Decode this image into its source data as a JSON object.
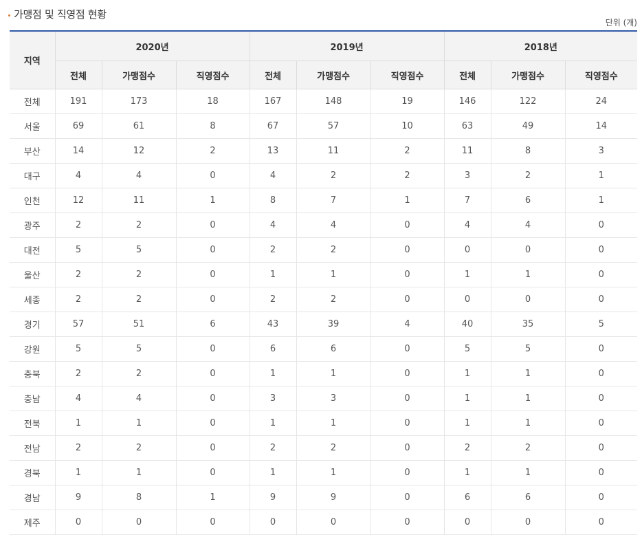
{
  "page": {
    "title": "가맹점 및 직영점 현황",
    "unit": "단위 (개)"
  },
  "table": {
    "region_header": "지역",
    "years": [
      "2020년",
      "2019년",
      "2018년"
    ],
    "sub_headers": [
      "전체",
      "가맹점수",
      "직영점수"
    ],
    "rows": [
      {
        "region": "전체",
        "values": [
          "191",
          "173",
          "18",
          "167",
          "148",
          "19",
          "146",
          "122",
          "24"
        ]
      },
      {
        "region": "서울",
        "values": [
          "69",
          "61",
          "8",
          "67",
          "57",
          "10",
          "63",
          "49",
          "14"
        ]
      },
      {
        "region": "부산",
        "values": [
          "14",
          "12",
          "2",
          "13",
          "11",
          "2",
          "11",
          "8",
          "3"
        ]
      },
      {
        "region": "대구",
        "values": [
          "4",
          "4",
          "0",
          "4",
          "2",
          "2",
          "3",
          "2",
          "1"
        ]
      },
      {
        "region": "인천",
        "values": [
          "12",
          "11",
          "1",
          "8",
          "7",
          "1",
          "7",
          "6",
          "1"
        ]
      },
      {
        "region": "광주",
        "values": [
          "2",
          "2",
          "0",
          "4",
          "4",
          "0",
          "4",
          "4",
          "0"
        ]
      },
      {
        "region": "대전",
        "values": [
          "5",
          "5",
          "0",
          "2",
          "2",
          "0",
          "0",
          "0",
          "0"
        ]
      },
      {
        "region": "울산",
        "values": [
          "2",
          "2",
          "0",
          "1",
          "1",
          "0",
          "1",
          "1",
          "0"
        ]
      },
      {
        "region": "세종",
        "values": [
          "2",
          "2",
          "0",
          "2",
          "2",
          "0",
          "0",
          "0",
          "0"
        ]
      },
      {
        "region": "경기",
        "values": [
          "57",
          "51",
          "6",
          "43",
          "39",
          "4",
          "40",
          "35",
          "5"
        ]
      },
      {
        "region": "강원",
        "values": [
          "5",
          "5",
          "0",
          "6",
          "6",
          "0",
          "5",
          "5",
          "0"
        ]
      },
      {
        "region": "충북",
        "values": [
          "2",
          "2",
          "0",
          "1",
          "1",
          "0",
          "1",
          "1",
          "0"
        ]
      },
      {
        "region": "충남",
        "values": [
          "4",
          "4",
          "0",
          "3",
          "3",
          "0",
          "1",
          "1",
          "0"
        ]
      },
      {
        "region": "전북",
        "values": [
          "1",
          "1",
          "0",
          "1",
          "1",
          "0",
          "1",
          "1",
          "0"
        ]
      },
      {
        "region": "전남",
        "values": [
          "2",
          "2",
          "0",
          "2",
          "2",
          "0",
          "2",
          "2",
          "0"
        ]
      },
      {
        "region": "경북",
        "values": [
          "1",
          "1",
          "0",
          "1",
          "1",
          "0",
          "1",
          "1",
          "0"
        ]
      },
      {
        "region": "경남",
        "values": [
          "9",
          "8",
          "1",
          "9",
          "9",
          "0",
          "6",
          "6",
          "0"
        ]
      },
      {
        "region": "제주",
        "values": [
          "0",
          "0",
          "0",
          "0",
          "0",
          "0",
          "0",
          "0",
          "0"
        ]
      }
    ]
  }
}
